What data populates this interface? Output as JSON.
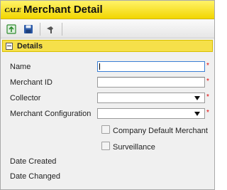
{
  "window": {
    "logo_text": "CALE",
    "title": "Merchant Detail"
  },
  "toolbar": {
    "buttons": [
      {
        "icon": "add-record-icon",
        "color": "#2e8b2e"
      },
      {
        "icon": "save-icon",
        "color": "#2c5aa8"
      },
      {
        "icon": "pin-icon",
        "color": "#555555"
      }
    ]
  },
  "section": {
    "title": "Details",
    "header_color": "#f6e04a"
  },
  "form": {
    "name_label": "Name",
    "name_value": "",
    "merchant_id_label": "Merchant ID",
    "merchant_id_value": "",
    "collector_label": "Collector",
    "collector_value": "",
    "merchant_configuration_label": "Merchant Configuration",
    "merchant_configuration_value": "",
    "required_marker": "*",
    "company_default_merchant_label": "Company Default Merchant",
    "company_default_merchant_checked": false,
    "surveillance_label": "Surveillance",
    "surveillance_checked": false,
    "date_created_label": "Date Created",
    "date_changed_label": "Date Changed"
  }
}
